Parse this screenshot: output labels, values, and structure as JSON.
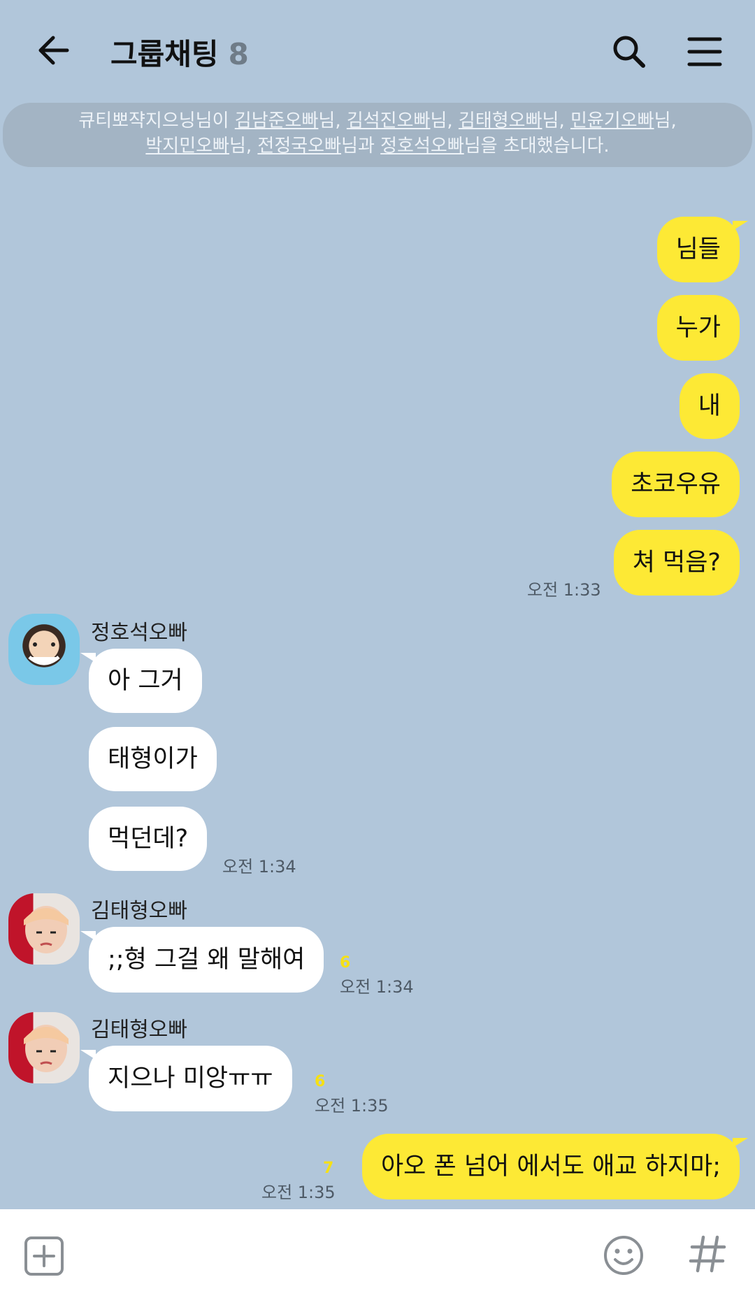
{
  "header": {
    "title": "그룹채팅",
    "member_count": "8"
  },
  "system_message": {
    "line1_prefix": "큐티뽀쟉지으닝님이 ",
    "line1_names": [
      "김남준오빠",
      "김석진오빠",
      "김태형오빠",
      "민윤기오빠"
    ],
    "line2_names": [
      "박지민오빠",
      "전정국오빠"
    ],
    "line2_last_name": "정호석오빠",
    "suffix_nim": "님",
    "sep": ", ",
    "conj": "님과 ",
    "ending": "님을 초대했습니다."
  },
  "messages_me_1": [
    "님들",
    "누가",
    "내",
    "초코우유",
    "쳐 먹음?"
  ],
  "time_me_1": "오전 1:33",
  "sender_1": {
    "name": "정호석오빠",
    "messages": [
      "아 그거",
      "태형이가",
      "먹던데?"
    ],
    "time": "오전 1:34"
  },
  "sender_2": {
    "name": "김태형오빠",
    "message": ";;형 그걸 왜 말해여",
    "unread": "6",
    "time": "오전 1:34"
  },
  "sender_3": {
    "name": "김태형오빠",
    "message": "지으나 미앙ㅠㅠ",
    "unread": "6",
    "time": "오전 1:35"
  },
  "me_2": {
    "message": "아오 폰 넘어 에서도 애교 하지마;",
    "unread": "7",
    "time": "오전 1:35"
  },
  "colors": {
    "background": "#b1c6da",
    "my_bubble": "#fde935",
    "other_bubble": "#ffffff",
    "unread": "#f6e014"
  },
  "icons": {
    "back": "arrow-left-icon",
    "search": "search-icon",
    "menu": "hamburger-icon",
    "plus": "plus-square-icon",
    "emoji": "smiley-icon",
    "hash": "hash-icon"
  }
}
